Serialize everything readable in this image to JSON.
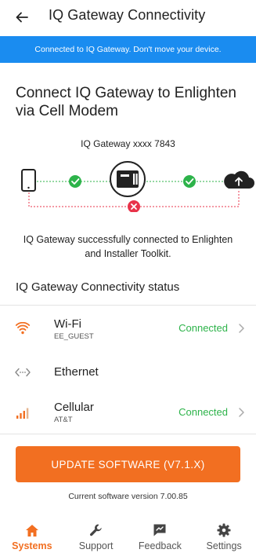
{
  "header": {
    "back_icon": "arrow-left-icon",
    "title": "IQ Gateway Connectivity"
  },
  "banner": {
    "text": "Connected to IQ Gateway. Don't move your device.",
    "color": "#1a8cf0"
  },
  "connect_section": {
    "title": "Connect IQ Gateway to Enlighten via Cell Modem",
    "gateway_label": "IQ Gateway xxxx 7843",
    "diagram": {
      "nodes": [
        "phone-icon",
        "gateway-icon",
        "cloud-upload-icon"
      ],
      "link_phone_gateway": "success",
      "link_gateway_cloud": "success",
      "link_phone_cloud": "error"
    },
    "success_message": "IQ Gateway successfully connected to Enlighten and Installer Toolkit."
  },
  "status_section": {
    "title": "IQ Gateway Connectivity status",
    "items": [
      {
        "name": "Wi-Fi",
        "subtitle": "EE_GUEST",
        "status": "Connected",
        "icon": "wifi-icon",
        "chevron": true
      },
      {
        "name": "Ethernet",
        "subtitle": "",
        "status": "",
        "icon": "ethernet-icon",
        "chevron": false
      },
      {
        "name": "Cellular",
        "subtitle": "AT&T",
        "status": "Connected",
        "icon": "cellular-signal-icon",
        "chevron": true
      }
    ]
  },
  "update_button": {
    "label": "UPDATE SOFTWARE (V7.1.X)",
    "color": "#f26f21"
  },
  "current_version": "Current software version 7.00.85",
  "bottom_nav": {
    "active": "Systems",
    "items": [
      {
        "label": "Systems",
        "icon": "home-icon"
      },
      {
        "label": "Support",
        "icon": "wrench-icon"
      },
      {
        "label": "Feedback",
        "icon": "feedback-icon"
      },
      {
        "label": "Settings",
        "icon": "gear-icon"
      }
    ]
  },
  "colors": {
    "success": "#2db34a",
    "error": "#e8334a",
    "accent": "#f26f21",
    "link_line": "#2db34a"
  }
}
